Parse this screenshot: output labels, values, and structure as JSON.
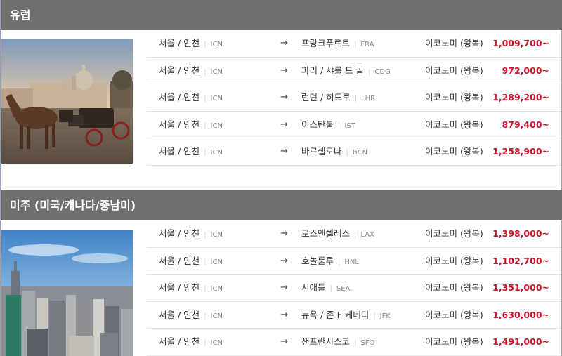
{
  "colors": {
    "header_bg": "#6f6f6f",
    "price": "#d0112b",
    "row_border": "#e3e3e3"
  },
  "icons": {
    "arrow": "arrow-right-icon"
  },
  "regions": [
    {
      "title": "유럽",
      "rows": [
        {
          "origin": "서울 / 인천",
          "origin_code": "ICN",
          "arrow": "→",
          "dest": "프랑크푸르트",
          "dest_code": "FRA",
          "fare": "이코노미 (왕복)",
          "price": "1,009,700~"
        },
        {
          "origin": "서울 / 인천",
          "origin_code": "ICN",
          "arrow": "→",
          "dest": "파리 / 샤를 드 골",
          "dest_code": "CDG",
          "fare": "이코노미 (왕복)",
          "price": "972,000~"
        },
        {
          "origin": "서울 / 인천",
          "origin_code": "ICN",
          "arrow": "→",
          "dest": "런던 / 히드로",
          "dest_code": "LHR",
          "fare": "이코노미 (왕복)",
          "price": "1,289,200~"
        },
        {
          "origin": "서울 / 인천",
          "origin_code": "ICN",
          "arrow": "→",
          "dest": "이스탄불",
          "dest_code": "IST",
          "fare": "이코노미 (왕복)",
          "price": "879,400~"
        },
        {
          "origin": "서울 / 인천",
          "origin_code": "ICN",
          "arrow": "→",
          "dest": "바르셀로나",
          "dest_code": "BCN",
          "fare": "이코노미 (왕복)",
          "price": "1,258,900~"
        }
      ]
    },
    {
      "title": "미주 (미국/캐나다/중남미)",
      "rows": [
        {
          "origin": "서울 / 인천",
          "origin_code": "ICN",
          "arrow": "→",
          "dest": "로스앤젤레스",
          "dest_code": "LAX",
          "fare": "이코노미 (왕복)",
          "price": "1,398,000~"
        },
        {
          "origin": "서울 / 인천",
          "origin_code": "ICN",
          "arrow": "→",
          "dest": "호놀룰루",
          "dest_code": "HNL",
          "fare": "이코노미 (왕복)",
          "price": "1,102,700~"
        },
        {
          "origin": "서울 / 인천",
          "origin_code": "ICN",
          "arrow": "→",
          "dest": "시애틀",
          "dest_code": "SEA",
          "fare": "이코노미 (왕복)",
          "price": "1,351,000~"
        },
        {
          "origin": "서울 / 인천",
          "origin_code": "ICN",
          "arrow": "→",
          "dest": "뉴욕 / 존 F 케네디",
          "dest_code": "JFK",
          "fare": "이코노미 (왕복)",
          "price": "1,630,000~"
        },
        {
          "origin": "서울 / 인천",
          "origin_code": "ICN",
          "arrow": "→",
          "dest": "샌프란시스코",
          "dest_code": "SFO",
          "fare": "이코노미 (왕복)",
          "price": "1,491,000~"
        }
      ]
    }
  ]
}
